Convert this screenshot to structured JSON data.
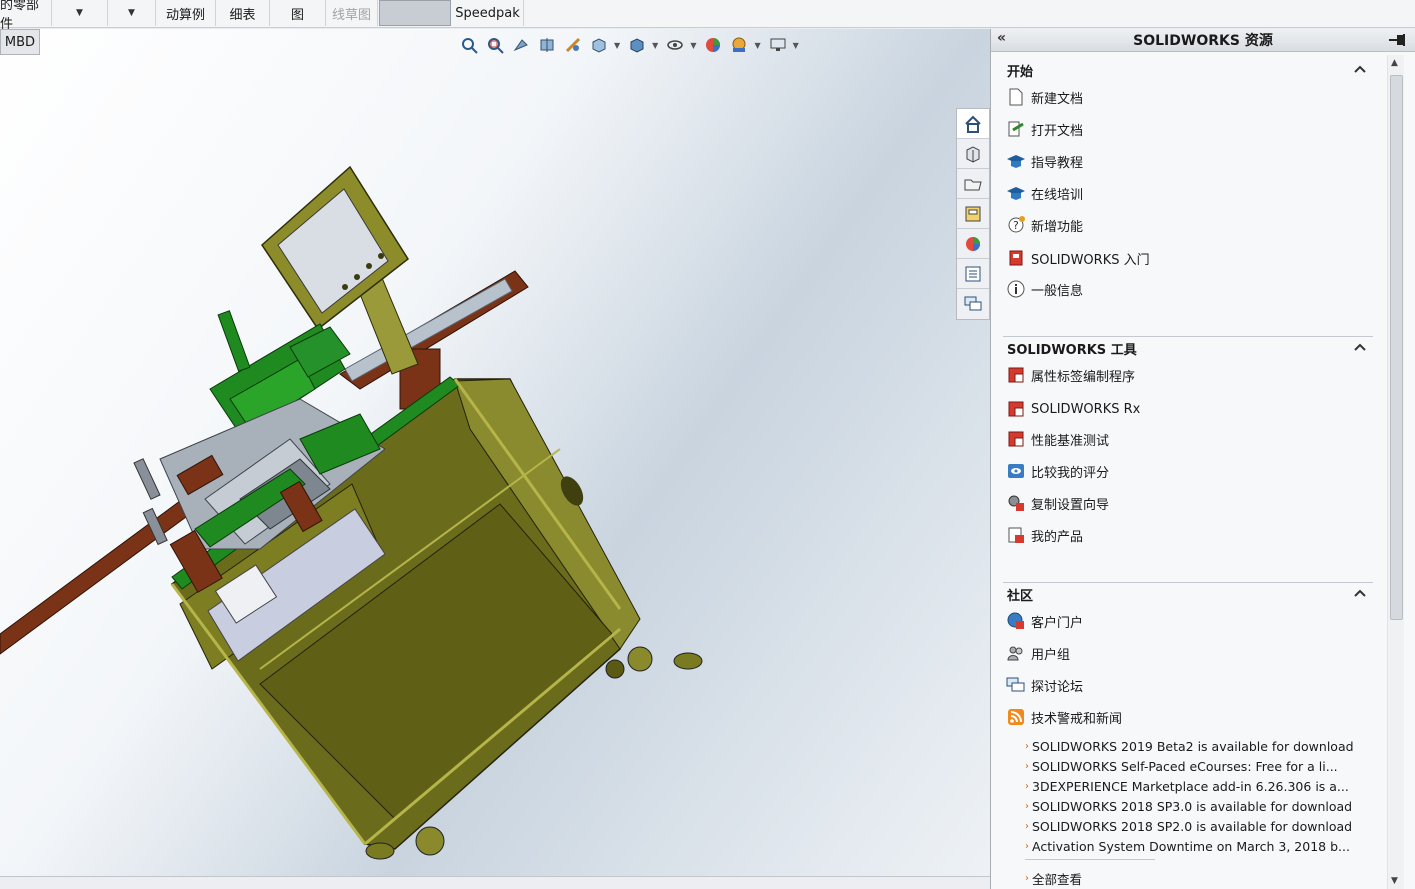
{
  "toolbar": {
    "items": [
      {
        "label": "的零部件"
      },
      {
        "label": ""
      },
      {
        "label": ""
      },
      {
        "label": "动算例"
      },
      {
        "label": "细表"
      },
      {
        "label": "图"
      },
      {
        "label": "线草图"
      },
      {
        "label": ""
      },
      {
        "label": "Speedpak"
      }
    ]
  },
  "viewport": {
    "mbd_tab": "MBD",
    "view_toolbar_icons": [
      "zoom-to-fit-icon",
      "zoom-area-icon",
      "previous-view-icon",
      "section-view-icon",
      "dynamic-annotation-icon",
      "view-orientation-icon",
      "display-style-icon",
      "hide-show-icon",
      "edit-appearance-icon",
      "apply-scene-icon",
      "view-settings-icon"
    ],
    "task_tabs": [
      "home-icon",
      "design-library-icon",
      "file-explorer-icon",
      "view-palette-icon",
      "appearances-icon",
      "custom-properties-icon",
      "forum-icon"
    ]
  },
  "task_pane": {
    "title": "SOLIDWORKS 资源",
    "sections": [
      {
        "title": "开始",
        "items": [
          {
            "label": "新建文档",
            "icon": "new-document-icon"
          },
          {
            "label": "打开文档",
            "icon": "open-document-icon"
          },
          {
            "label": "指导教程",
            "icon": "tutorials-icon"
          },
          {
            "label": "在线培训",
            "icon": "online-training-icon"
          },
          {
            "label": "新增功能",
            "icon": "whats-new-icon"
          },
          {
            "label": "SOLIDWORKS 入门",
            "icon": "intro-icon"
          },
          {
            "label": "一般信息",
            "icon": "info-icon"
          }
        ]
      },
      {
        "title": "SOLIDWORKS 工具",
        "items": [
          {
            "label": "属性标签编制程序",
            "icon": "property-tab-builder-icon"
          },
          {
            "label": "SOLIDWORKS Rx",
            "icon": "solidworks-rx-icon"
          },
          {
            "label": "性能基准测试",
            "icon": "benchmark-icon"
          },
          {
            "label": "比较我的评分",
            "icon": "compare-score-icon"
          },
          {
            "label": "复制设置向导",
            "icon": "copy-settings-icon"
          },
          {
            "label": "我的产品",
            "icon": "my-products-icon"
          }
        ]
      },
      {
        "title": "社区",
        "items": [
          {
            "label": "客户门户",
            "icon": "customer-portal-icon"
          },
          {
            "label": "用户组",
            "icon": "user-groups-icon"
          },
          {
            "label": "探讨论坛",
            "icon": "forum-icon"
          },
          {
            "label": "技术警戒和新闻",
            "icon": "rss-icon"
          }
        ],
        "news": [
          "SOLIDWORKS 2019 Beta2 is available for download",
          "SOLIDWORKS Self-Paced eCourses: Free for a li...",
          "3DEXPERIENCE Marketplace add-in 6.26.306 is a...",
          "SOLIDWORKS 2018 SP3.0 is available for download",
          "SOLIDWORKS 2018 SP2.0 is available for download",
          "Activation System Downtime on March 3, 2018 b..."
        ],
        "view_all": "全部查看"
      }
    ]
  },
  "colors": {
    "frame_olive": "#6b6b1c",
    "frame_light": "#9a9a3a",
    "green_parts": "#1f8a1f",
    "brown_parts": "#7a3317",
    "news_arrow": "#d46a00"
  }
}
